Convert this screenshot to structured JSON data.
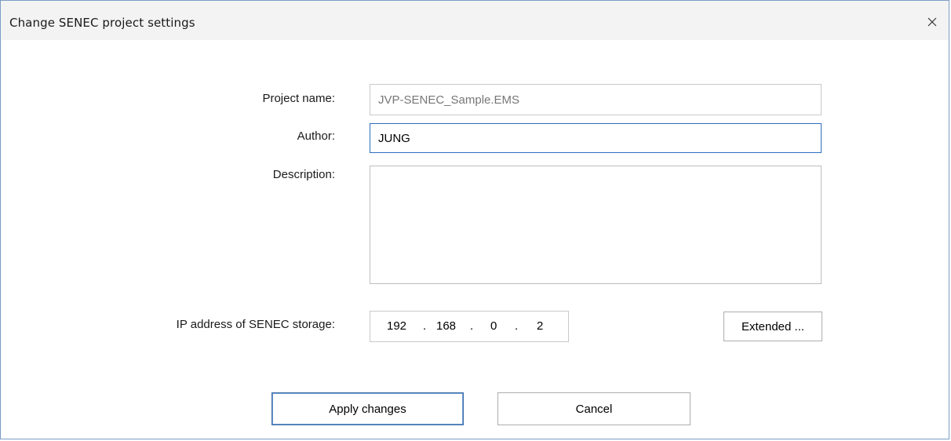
{
  "window": {
    "title": "Change SENEC project settings",
    "close_icon": "close-icon"
  },
  "form": {
    "project_name_label": "Project name:",
    "project_name_value": "JVP-SENEC_Sample.EMS",
    "author_label": "Author:",
    "author_value": "JUNG",
    "description_label": "Description:",
    "description_value": "",
    "ip_label": "IP address of SENEC storage:",
    "ip": {
      "octet1": "192",
      "octet2": "168",
      "octet3": "0",
      "octet4": "2",
      "dot": "."
    },
    "extended_button": "Extended ..."
  },
  "buttons": {
    "apply": "Apply changes",
    "cancel": "Cancel"
  },
  "colors": {
    "focus_border": "#2f6fbf",
    "window_border": "#7a9cc4",
    "titlebar_bg": "#f3f3f3"
  }
}
